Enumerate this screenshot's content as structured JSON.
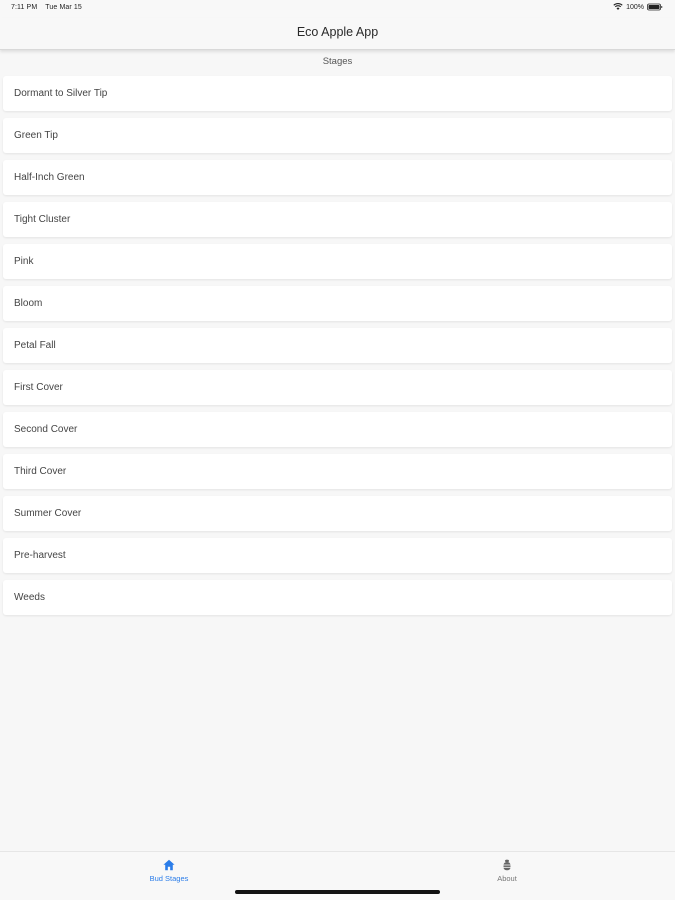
{
  "status_bar": {
    "time": "7:11 PM",
    "date": "Tue Mar 15",
    "battery": "100%",
    "wifi_icon": "wifi-icon",
    "battery_icon": "battery-icon"
  },
  "nav": {
    "title": "Eco Apple App"
  },
  "section": {
    "header": "Stages"
  },
  "stages": [
    {
      "label": "Dormant to Silver Tip"
    },
    {
      "label": "Green Tip"
    },
    {
      "label": "Half-Inch Green"
    },
    {
      "label": "Tight Cluster"
    },
    {
      "label": "Pink"
    },
    {
      "label": "Bloom"
    },
    {
      "label": "Petal Fall"
    },
    {
      "label": "First Cover"
    },
    {
      "label": "Second Cover"
    },
    {
      "label": "Third Cover"
    },
    {
      "label": "Summer Cover"
    },
    {
      "label": "Pre-harvest"
    },
    {
      "label": "Weeds"
    }
  ],
  "tab_bar": {
    "tabs": [
      {
        "label": "Bud Stages",
        "icon": "home-icon",
        "active": true
      },
      {
        "label": "About",
        "icon": "bug-icon",
        "active": false
      }
    ]
  },
  "colors": {
    "accent": "#2b7de9",
    "background": "#f7f7f7",
    "card": "#ffffff"
  }
}
